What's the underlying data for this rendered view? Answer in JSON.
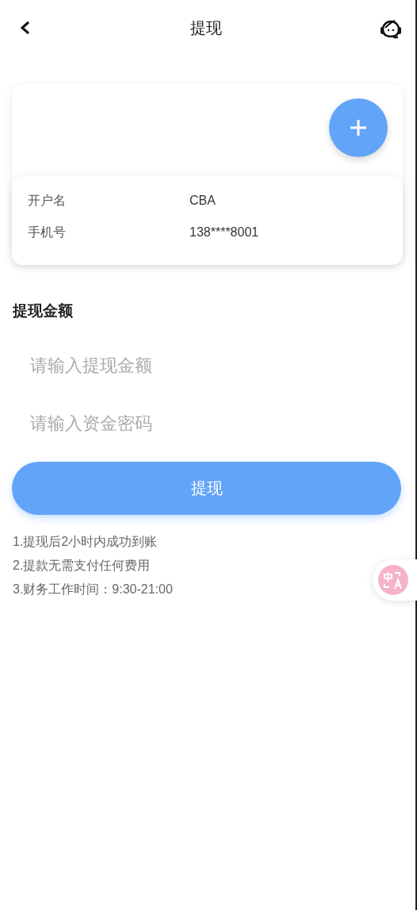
{
  "header": {
    "title": "提现"
  },
  "account": {
    "fields": [
      {
        "label": "开户名",
        "value": "CBA"
      },
      {
        "label": "手机号",
        "value": "138****8001"
      }
    ]
  },
  "amount_section": {
    "title": "提现金额"
  },
  "fields": [
    {
      "placeholder": "请输入提现金额"
    },
    {
      "placeholder": "请输入资金密码"
    }
  ],
  "submit": {
    "label": "提现"
  },
  "notes": [
    "1.提现后2小时内成功到账",
    "2.提款无需支付任何费用",
    "3.财务工作时间：9:30-21:00"
  ]
}
